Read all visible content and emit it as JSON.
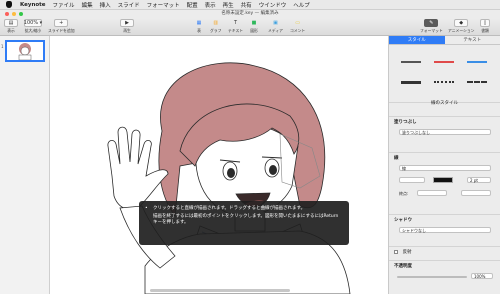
{
  "menubar": {
    "app": "Keynote",
    "items": [
      "ファイル",
      "編集",
      "挿入",
      "スライド",
      "フォーマット",
      "配置",
      "表示",
      "再生",
      "共有",
      "ウインドウ",
      "ヘルプ"
    ]
  },
  "window": {
    "title": "名称未設定.key — 編集済み"
  },
  "toolbar": {
    "left": [
      {
        "label": "表示",
        "glyph": "▤"
      },
      {
        "label": "拡大/縮小",
        "glyph": "100% ▾"
      },
      {
        "label": "スライドを追加",
        "glyph": "+"
      }
    ],
    "play": {
      "label": "再生",
      "glyph": "▶"
    },
    "center": [
      {
        "label": "表",
        "glyph": "▦"
      },
      {
        "label": "グラフ",
        "glyph": "▥"
      },
      {
        "label": "テキスト",
        "glyph": "T"
      },
      {
        "label": "図形",
        "glyph": "■"
      },
      {
        "label": "メディア",
        "glyph": "▣"
      },
      {
        "label": "コメント",
        "glyph": "▭"
      }
    ],
    "right": [
      {
        "label": "フォーマット",
        "glyph": "✎"
      },
      {
        "label": "アニメーション",
        "glyph": "◆"
      },
      {
        "label": "書類",
        "glyph": "▯"
      }
    ]
  },
  "slides": {
    "current": "1"
  },
  "tooltip": {
    "line1": "クリックすると直線が描画されます。ドラッグすると曲線が描画されます。",
    "line2": "描画を終了するには最初のポイントをクリックします。図形を開いたままにするにはReturnキーを押します。"
  },
  "inspector": {
    "tab_style": "スタイル",
    "tab_text": "テキスト",
    "styles_label": "線のスタイル",
    "fill": {
      "title": "塗りつぶし",
      "value": "塗りつぶしなし"
    },
    "stroke": {
      "title": "線",
      "type": "線",
      "width": "2 pt",
      "endpoints": "終点:"
    },
    "shadow": {
      "title": "シャドウ",
      "value": "シャドウなし"
    },
    "reflection": {
      "label": "反射"
    },
    "opacity": {
      "label": "不透明度",
      "value": "100%"
    }
  },
  "colors": {
    "accent": "#2f7cf6",
    "hair": "#c48a8a",
    "skin": "#ffffff",
    "outline": "#2b2b2b"
  }
}
